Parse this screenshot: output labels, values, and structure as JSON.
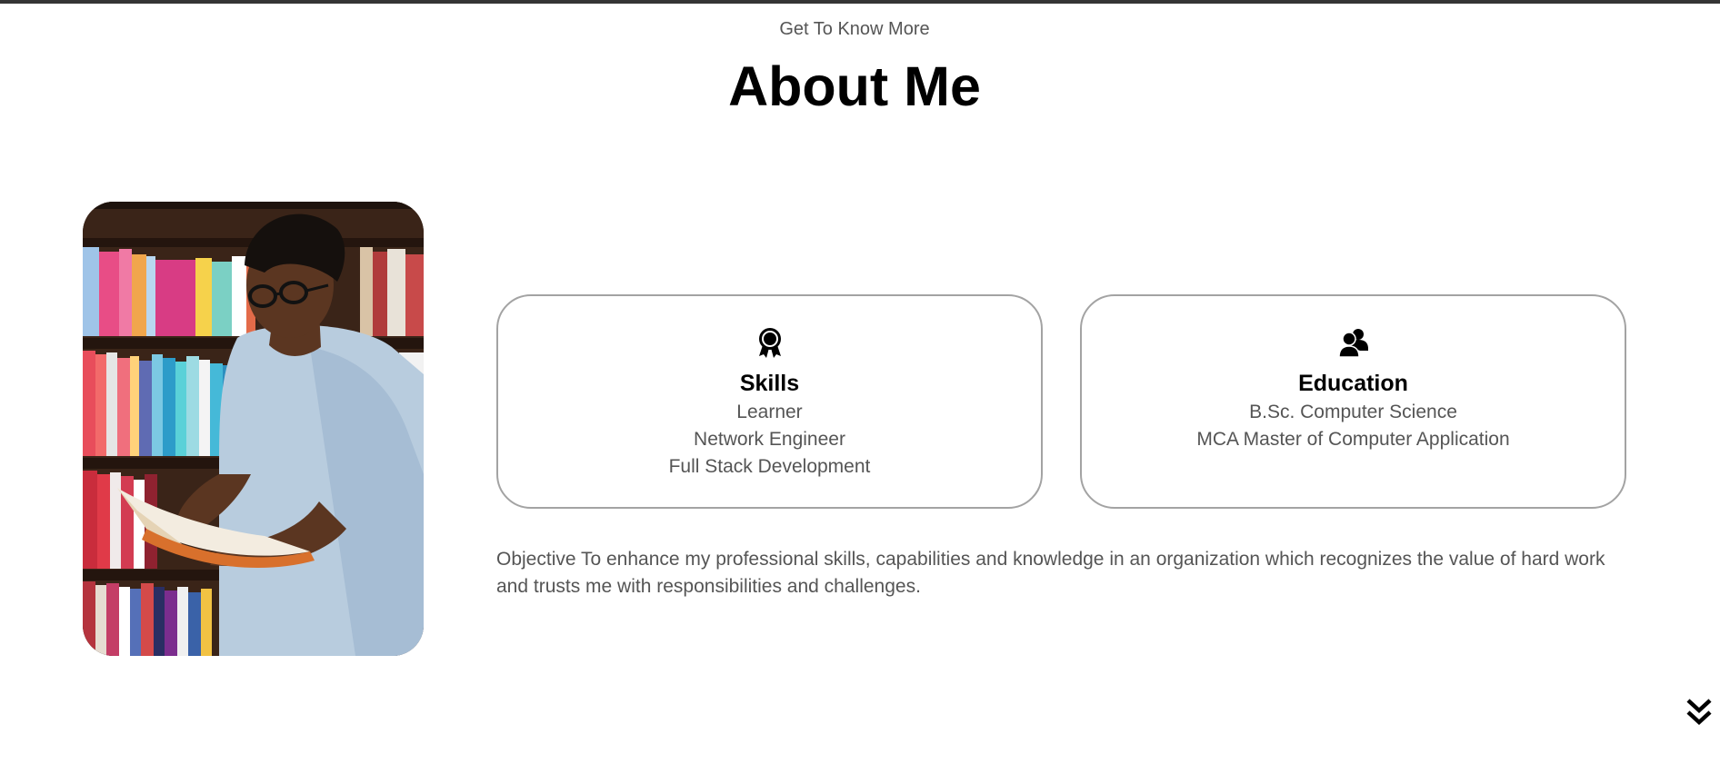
{
  "header": {
    "subtitle": "Get To Know More",
    "title": "About Me"
  },
  "profile_photo": {
    "icon": "profile-photo"
  },
  "skills_card": {
    "icon": "award-icon",
    "heading": "Skills",
    "items": [
      "Learner",
      "Network Engineer",
      "Full Stack Development"
    ]
  },
  "education_card": {
    "icon": "users-icon",
    "heading": "Education",
    "items": [
      "B.Sc. Computer Science",
      "MCA Master of Computer Application"
    ]
  },
  "objective": {
    "text": "Objective To enhance my professional skills, capabilities and knowledge in an organization which recognizes the value of hard work and trusts me with responsibilities and challenges."
  },
  "scroll_down": {
    "icon": "double-chevron-down-icon"
  },
  "colors": {
    "text_primary": "#000000",
    "text_secondary": "#555555",
    "card_border": "#a3a3a3",
    "top_rule": "#353535"
  }
}
